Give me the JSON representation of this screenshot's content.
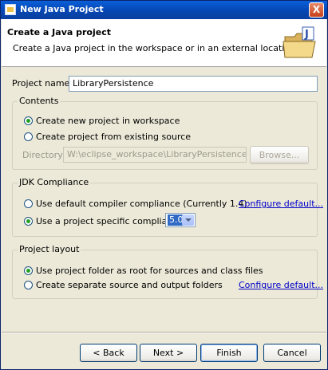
{
  "window": {
    "title": "New Java Project",
    "close_label": "X"
  },
  "header": {
    "title": "Create a Java project",
    "description": "Create a Java project in the workspace or in an external location.",
    "banner_icon": "java-project-folder-icon"
  },
  "project_name": {
    "label": "Project name:",
    "value": "LibraryPersistence"
  },
  "contents": {
    "title": "Contents",
    "option_workspace": "Create new project in workspace",
    "option_existing": "Create project from existing source",
    "selected": "workspace",
    "directory_label": "Directory:",
    "directory_value": "W:\\eclipse_workspace\\LibraryPersistence",
    "browse_label": "Browse..."
  },
  "jdk": {
    "title": "JDK Compliance",
    "option_default": "Use default compiler compliance (Currently 1.4)",
    "option_specific": "Use a project specific compliance:",
    "selected": "specific",
    "compliance_value": "5.0",
    "configure_label": "Configure default..."
  },
  "layout": {
    "title": "Project layout",
    "option_root": "Use project folder as root for sources and class files",
    "option_separate": "Create separate source and output folders",
    "selected": "root",
    "configure_label": "Configure default..."
  },
  "buttons": {
    "back": "< Back",
    "next": "Next >",
    "finish": "Finish",
    "cancel": "Cancel"
  },
  "colors": {
    "titlebar": "#0a5fd8",
    "link": "#0000c8",
    "dialog_bg": "#ece9d8"
  }
}
